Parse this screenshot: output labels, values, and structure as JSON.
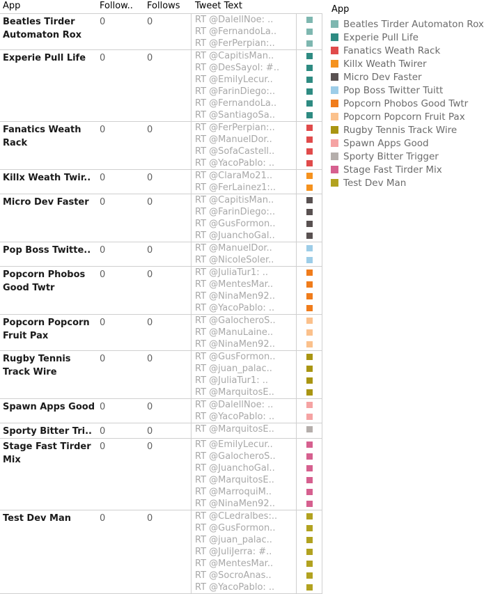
{
  "table": {
    "columns": [
      "App",
      "Follow..",
      "Follows",
      "Tweet Text"
    ],
    "rows": [
      {
        "app": "Beatles Tirder\nAutomaton Rox",
        "followers": "0",
        "follows": "0",
        "color": "#7eb7b0",
        "tweets": [
          "RT @DalellNoe: ..",
          "RT @FernandoLa..",
          "RT @FerPerpian:.."
        ]
      },
      {
        "app": "Experie Pull Life",
        "followers": "0",
        "follows": "0",
        "color": "#2e8b82",
        "tweets": [
          "RT @CapitisMan..",
          "RT @DesSayol: #..",
          "RT @EmilyLecur..",
          "RT @FarinDiego:..",
          "RT @FernandoLa..",
          "RT @SantiagoSa.."
        ]
      },
      {
        "app": "Fanatics Weath\nRack",
        "followers": "0",
        "follows": "0",
        "color": "#e04b4b",
        "tweets": [
          "RT @FerPerpian:..",
          "RT @ManuelDor..",
          "RT @SofaCastell..",
          "RT @YacoPablo: .."
        ]
      },
      {
        "app": "Killx Weath Twir..",
        "followers": "0",
        "follows": "0",
        "color": "#f5921e",
        "tweets": [
          "RT @ClaraMo21..",
          "RT @FerLainez1:.."
        ]
      },
      {
        "app": "Micro Dev Faster",
        "followers": "0",
        "follows": "0",
        "color": "#595151",
        "tweets": [
          "RT @CapitisMan..",
          "RT @FarinDiego:..",
          "RT @GusFormon..",
          "RT @JuanchoGal.."
        ]
      },
      {
        "app": "Pop Boss Twitte..",
        "followers": "0",
        "follows": "0",
        "color": "#9dcde8",
        "tweets": [
          "RT @ManuelDor..",
          "RT @NicoleSoler.."
        ]
      },
      {
        "app": "Popcorn Phobos\nGood Twtr",
        "followers": "0",
        "follows": "0",
        "color": "#f07c1b",
        "tweets": [
          "RT @JuliaTur1: ..",
          "RT @MentesMar..",
          "RT @NinaMen92..",
          "RT @YacoPablo: .."
        ]
      },
      {
        "app": "Popcorn Popcorn\nFruit Pax",
        "followers": "0",
        "follows": "0",
        "color": "#fbc18c",
        "tweets": [
          "RT @GalocheroS..",
          "RT @ManuLaine..",
          "RT @NinaMen92.."
        ]
      },
      {
        "app": "Rugby Tennis\nTrack Wire",
        "followers": "0",
        "follows": "0",
        "color": "#a99512",
        "tweets": [
          "RT @GusFormon..",
          "RT @juan_palac..",
          "RT @JuliaTur1: ..",
          "RT @MarquitosE.."
        ]
      },
      {
        "app": "Spawn Apps Good",
        "followers": "0",
        "follows": "0",
        "color": "#f5a3a3",
        "tweets": [
          "RT @DalellNoe: ..",
          "RT @YacoPablo: .."
        ]
      },
      {
        "app": "Sporty Bitter Tri..",
        "followers": "0",
        "follows": "0",
        "color": "#b5aeab",
        "tweets": [
          "RT @MarquitosE.."
        ]
      },
      {
        "app": "Stage Fast Tirder\nMix",
        "followers": "0",
        "follows": "0",
        "color": "#d6608f",
        "tweets": [
          "RT @EmilyLecur..",
          "RT @GalocheroS..",
          "RT @JuanchoGal..",
          "RT @MarquitosE..",
          "RT @MarroquiM..",
          "RT @NinaMen92.."
        ]
      },
      {
        "app": "Test Dev Man",
        "followers": "0",
        "follows": "0",
        "color": "#b2a220",
        "tweets": [
          "RT @CLedralbes:..",
          "RT @GusFormon..",
          "RT @juan_palac..",
          "RT @JuliJerra: #..",
          "RT @MentesMar..",
          "RT @SocroAnas..",
          "RT @YacoPablo: .."
        ]
      }
    ]
  },
  "legend": {
    "title": "App",
    "items": [
      {
        "label": "Beatles Tirder Automaton Rox",
        "color": "#7eb7b0"
      },
      {
        "label": "Experie Pull Life",
        "color": "#2e8b82"
      },
      {
        "label": "Fanatics Weath Rack",
        "color": "#e04b4b"
      },
      {
        "label": "Killx Weath Twirer",
        "color": "#f5921e"
      },
      {
        "label": "Micro Dev Faster",
        "color": "#595151"
      },
      {
        "label": "Pop Boss Twitter Tuitt",
        "color": "#9dcde8"
      },
      {
        "label": "Popcorn Phobos Good Twtr",
        "color": "#f07c1b"
      },
      {
        "label": "Popcorn Popcorn Fruit Pax",
        "color": "#fbc18c"
      },
      {
        "label": "Rugby Tennis Track Wire",
        "color": "#a99512"
      },
      {
        "label": "Spawn Apps Good",
        "color": "#f5a3a3"
      },
      {
        "label": "Sporty Bitter Trigger",
        "color": "#b5aeab"
      },
      {
        "label": "Stage Fast Tirder Mix",
        "color": "#d6608f"
      },
      {
        "label": "Test Dev Man",
        "color": "#b2a220"
      }
    ]
  }
}
